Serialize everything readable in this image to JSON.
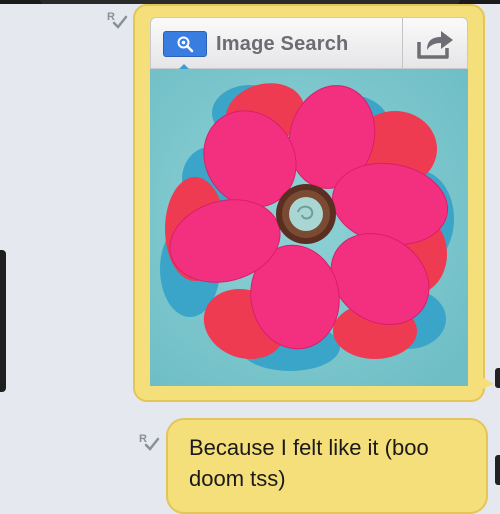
{
  "toolbar": {
    "image_search_label": "Image Search"
  },
  "messages": [
    {
      "type": "image",
      "read_receipt": "R"
    },
    {
      "type": "text",
      "read_receipt": "R",
      "text": "Because I felt like it (boo doom tss)"
    }
  ],
  "icons": {
    "search": "magnifier-icon",
    "share": "share-arrow-icon",
    "read": "read-receipt-icon"
  },
  "colors": {
    "bubble": "#f4df7a",
    "bubble_border": "#e3c657",
    "search_button": "#3a7de0",
    "background": "#e5e8ee"
  }
}
